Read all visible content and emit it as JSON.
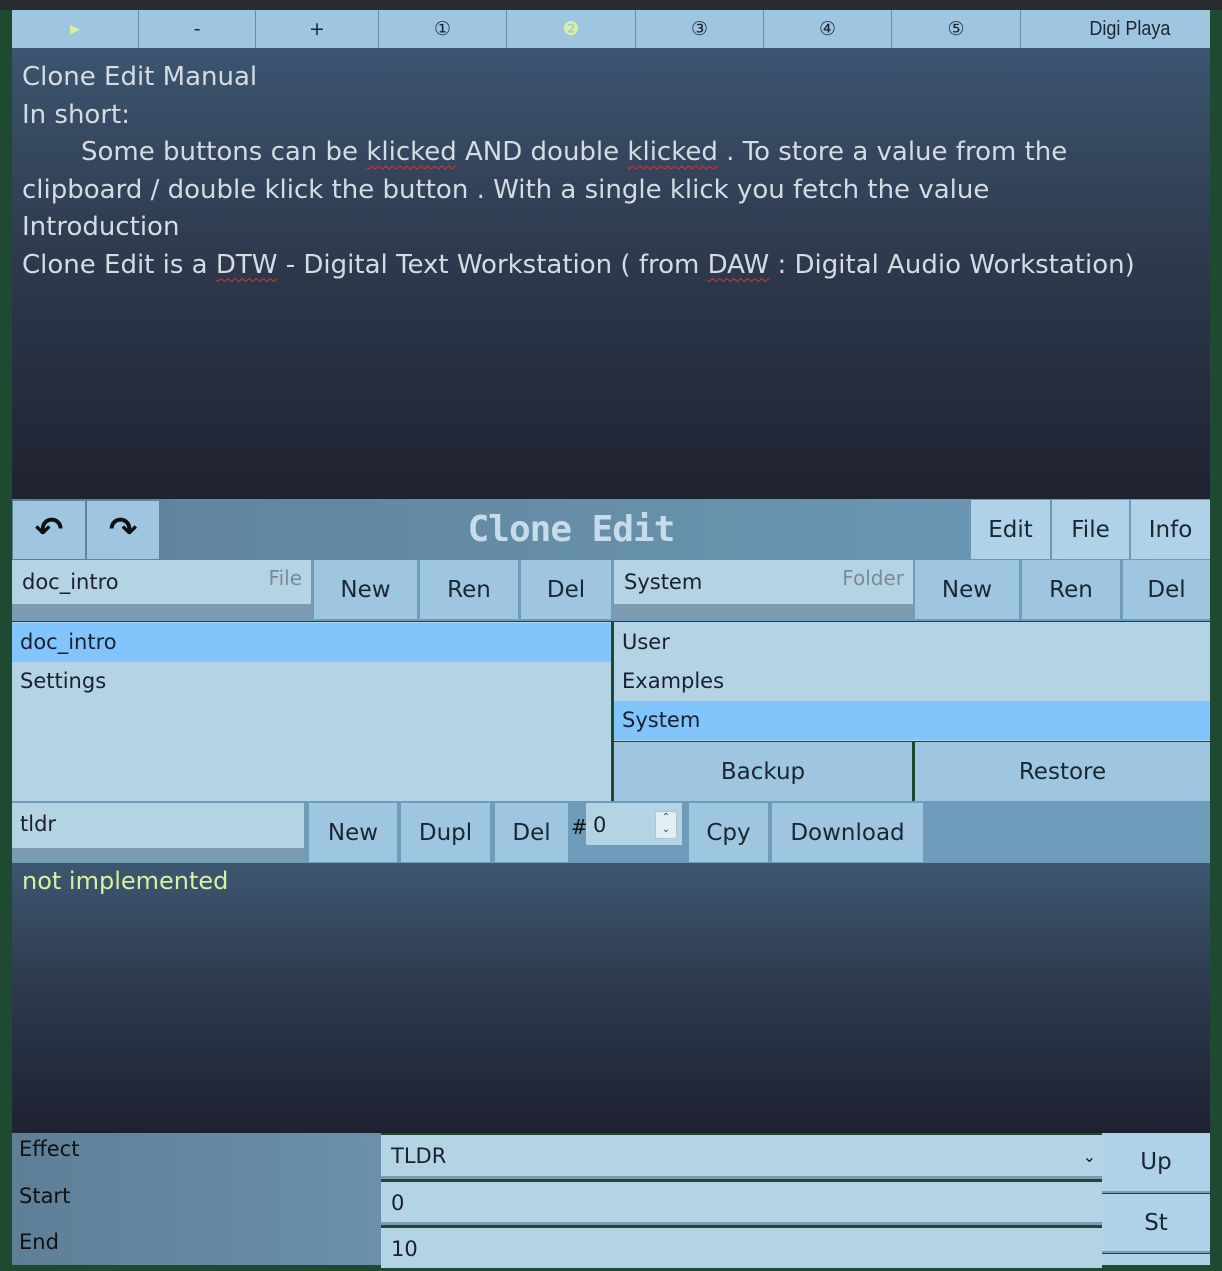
{
  "toolbar": {
    "play_icon": "play-icon",
    "minus_label": "-",
    "plus_label": "+",
    "slots": [
      "①",
      "❷",
      "③",
      "④",
      "⑤"
    ],
    "selected_slot": 2,
    "title": "Digi Playa"
  },
  "manual": {
    "line1": "Clone Edit Manual",
    "line2": "In short:",
    "line3a": "Some buttons can be ",
    "line3b": "klicked",
    "line3c": " AND double ",
    "line3d": "klicked",
    "line3e": " . To store a value from the",
    "line4": "clipboard / double klick the button . With a single klick you fetch the value",
    "line5": "Introduction",
    "line6a": "Clone Edit is a ",
    "line6b": "DTW",
    "line6c": " - Digital Text Workstation ( from ",
    "line6d": "DAW",
    "line6e": " : Digital Audio Workstation)"
  },
  "titlebar": {
    "undo_icon": "↶",
    "redo_icon": "↷",
    "title": "Clone Edit",
    "menu": [
      "Edit",
      "File",
      "Info"
    ]
  },
  "file": {
    "value": "doc_intro",
    "placeholder": "File",
    "new_label": "New",
    "ren_label": "Ren",
    "del_label": "Del",
    "items": [
      "doc_intro",
      "Settings"
    ],
    "selected": "doc_intro"
  },
  "folder": {
    "value": "System",
    "placeholder": "Folder",
    "new_label": "New",
    "ren_label": "Ren",
    "del_label": "Del",
    "items": [
      "User",
      "Examples",
      "System"
    ],
    "selected": "System",
    "backup_label": "Backup",
    "restore_label": "Restore"
  },
  "clone": {
    "value": "tldr",
    "new_label": "New",
    "dupl_label": "Dupl",
    "del_label": "Del",
    "hash_label": "#",
    "count": "0",
    "cpy_label": "Cpy",
    "download_label": "Download"
  },
  "output": {
    "text": "not implemented"
  },
  "effect": {
    "effect_label": "Effect",
    "start_label": "Start",
    "end_label": "End",
    "effect_value": "TLDR",
    "start_value": "0",
    "end_value": "10",
    "up_label": "Up",
    "st_label": "St"
  }
}
